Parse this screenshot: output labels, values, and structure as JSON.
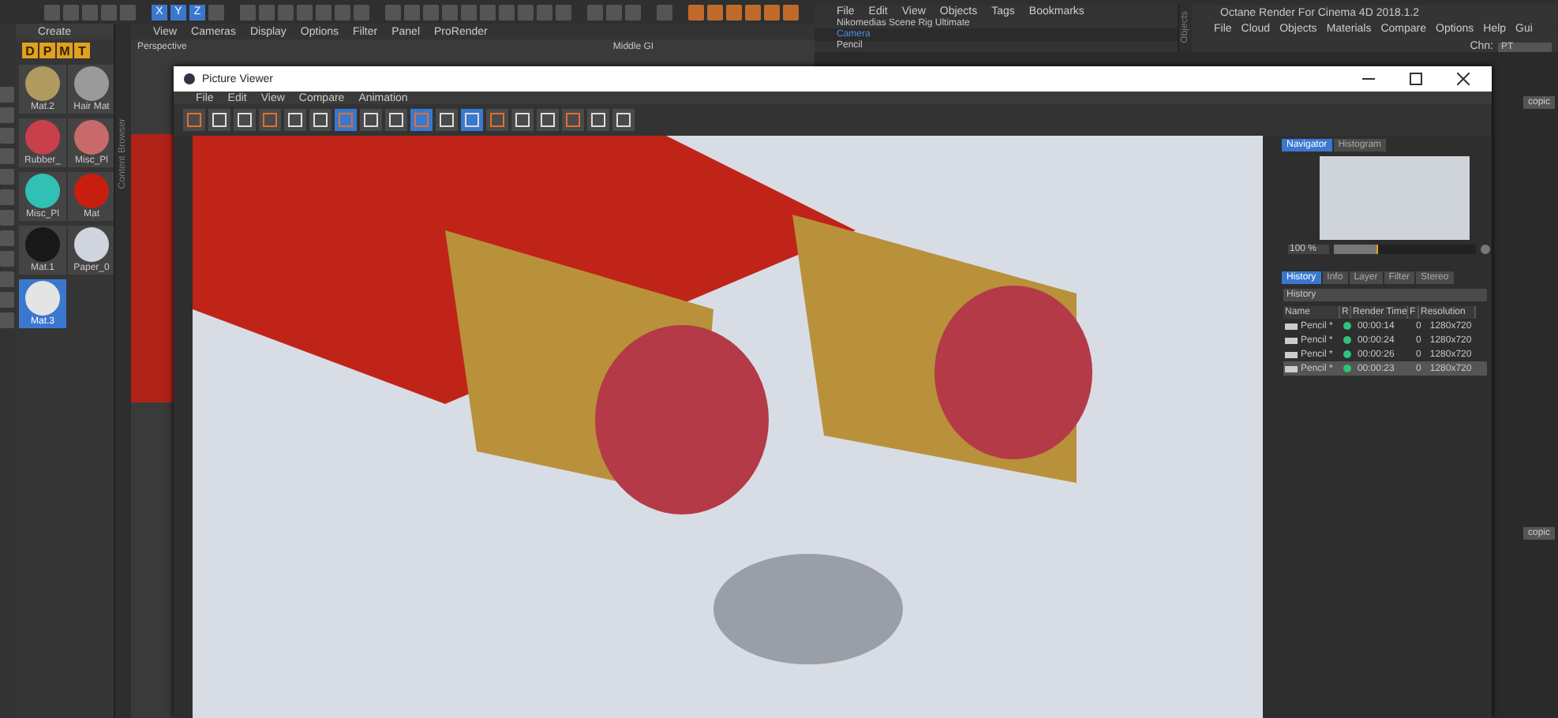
{
  "main_toolbar": {
    "axis_buttons": [
      {
        "label": "X",
        "selected": true
      },
      {
        "label": "Y",
        "selected": true
      },
      {
        "label": "Z",
        "selected": true
      }
    ]
  },
  "material_manager": {
    "menu": "Create",
    "filters": [
      "D",
      "P",
      "M",
      "T"
    ],
    "materials": [
      {
        "name": "Mat.2",
        "color": "#b09a60",
        "selected": false
      },
      {
        "name": "Hair Mat",
        "color": "#9a9a9a",
        "selected": false
      },
      {
        "name": "Rubber_",
        "color": "#c8404a",
        "selected": false
      },
      {
        "name": "Misc_Pl",
        "color": "#c86a6a",
        "selected": false
      },
      {
        "name": "Misc_Pl",
        "color": "#30c0b4",
        "selected": false
      },
      {
        "name": "Mat",
        "color": "#c81e10",
        "selected": false
      },
      {
        "name": "Mat.1",
        "color": "#181818",
        "selected": false
      },
      {
        "name": "Paper_0",
        "color": "#d0d4dc",
        "selected": false
      },
      {
        "name": "Mat.3",
        "color": "#e4e4e4",
        "selected": true
      }
    ]
  },
  "content_browser": {
    "tab": "Content Browser"
  },
  "viewport": {
    "menu": [
      "View",
      "Cameras",
      "Display",
      "Options",
      "Filter",
      "Panel",
      "ProRender"
    ],
    "camera": "Perspective",
    "mode": "Middle GI"
  },
  "object_manager": {
    "menu": [
      "File",
      "Edit",
      "View",
      "Objects",
      "Tags",
      "Bookmarks"
    ],
    "side_tab": "Objects",
    "objects": [
      {
        "name": "Nikomedias Scene Rig Ultimate",
        "selected": false
      },
      {
        "name": "Camera",
        "selected": true
      },
      {
        "name": "Pencil",
        "selected": false
      }
    ]
  },
  "octane": {
    "title": "Octane Render For Cinema 4D 2018.1.2",
    "menu": [
      "File",
      "Cloud",
      "Objects",
      "Materials",
      "Compare",
      "Options",
      "Help",
      "Gui"
    ],
    "channel_label": "Chn:",
    "channel": "PT"
  },
  "attributes": {
    "buttons": [
      "copic",
      "copic"
    ]
  },
  "picture_viewer": {
    "title": "Picture Viewer",
    "menu": [
      "File",
      "Edit",
      "View",
      "Compare",
      "Animation"
    ],
    "toolbar": [
      {
        "selected": false
      },
      {
        "selected": false
      },
      {
        "selected": false
      },
      {
        "selected": false
      },
      {
        "selected": false
      },
      {
        "selected": false
      },
      {
        "selected": true
      },
      {
        "selected": false
      },
      {
        "selected": false
      },
      {
        "selected": true
      },
      {
        "selected": false
      },
      {
        "selected": true
      },
      {
        "selected": false
      },
      {
        "selected": false
      },
      {
        "selected": false
      },
      {
        "selected": false
      },
      {
        "selected": false
      },
      {
        "selected": false
      }
    ],
    "nav_tabs": [
      {
        "label": "Navigator",
        "selected": true
      },
      {
        "label": "Histogram",
        "selected": false
      }
    ],
    "zoom": "100 %",
    "zoom_level": {
      "level": 0.3
    },
    "info_tabs": [
      {
        "label": "History",
        "selected": true
      },
      {
        "label": "Info",
        "selected": false
      },
      {
        "label": "Layer",
        "selected": false
      },
      {
        "label": "Filter",
        "selected": false
      },
      {
        "label": "Stereo",
        "selected": false
      }
    ],
    "history_title": "History",
    "columns": [
      "Name",
      "R",
      "Render Time",
      "F",
      "Resolution"
    ],
    "rows": [
      {
        "name": "Pencil *",
        "time": "00:00:14",
        "f": "0",
        "resolution": "1280x720",
        "selected": false
      },
      {
        "name": "Pencil *",
        "time": "00:00:24",
        "f": "0",
        "resolution": "1280x720",
        "selected": false
      },
      {
        "name": "Pencil *",
        "time": "00:00:26",
        "f": "0",
        "resolution": "1280x720",
        "selected": false
      },
      {
        "name": "Pencil *",
        "time": "00:00:23",
        "f": "0",
        "resolution": "1280x720",
        "selected": true
      }
    ]
  }
}
